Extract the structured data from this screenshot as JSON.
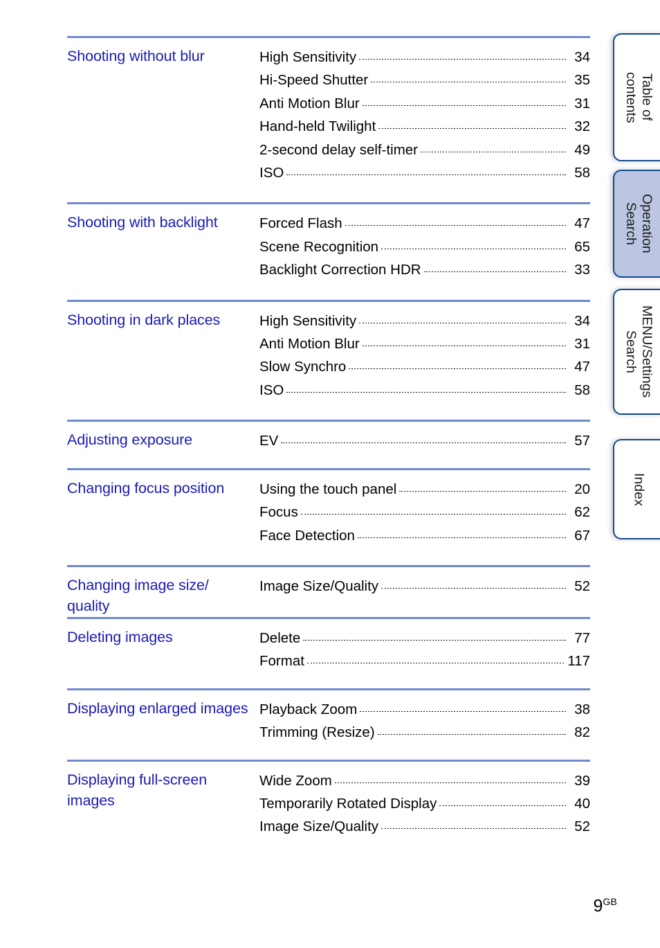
{
  "document": {
    "page_number": "9",
    "page_suffix": "GB"
  },
  "side_tabs": [
    {
      "label": "Table of\ncontents",
      "active": false
    },
    {
      "label": "Operation\nSearch",
      "active": true
    },
    {
      "label": "MENU/Settings\nSearch",
      "active": false
    },
    {
      "label": "Index",
      "active": false
    }
  ],
  "toc": {
    "sections": [
      {
        "title": "Shooting without blur",
        "entries": [
          {
            "label": "High Sensitivity",
            "page": "34"
          },
          {
            "label": "Hi-Speed Shutter",
            "page": "35"
          },
          {
            "label": "Anti Motion Blur",
            "page": "31"
          },
          {
            "label": "Hand-held Twilight",
            "page": "32"
          },
          {
            "label": "2-second delay self-timer",
            "page": "49"
          },
          {
            "label": "ISO",
            "page": "58"
          }
        ]
      },
      {
        "title": "Shooting with backlight",
        "entries": [
          {
            "label": "Forced Flash",
            "page": "47"
          },
          {
            "label": "Scene Recognition",
            "page": "65"
          },
          {
            "label": "Backlight Correction HDR",
            "page": "33"
          }
        ]
      },
      {
        "title": "Shooting in dark places",
        "entries": [
          {
            "label": "High Sensitivity",
            "page": "34"
          },
          {
            "label": "Anti Motion Blur",
            "page": "31"
          },
          {
            "label": "Slow Synchro",
            "page": "47"
          },
          {
            "label": "ISO",
            "page": "58"
          }
        ]
      },
      {
        "title": "Adjusting exposure",
        "entries": [
          {
            "label": "EV",
            "page": "57"
          }
        ]
      },
      {
        "title": "Changing focus position",
        "entries": [
          {
            "label": "Using the touch panel",
            "page": "20"
          },
          {
            "label": "Focus",
            "page": "62"
          },
          {
            "label": "Face Detection",
            "page": "67"
          }
        ]
      },
      {
        "title": "Changing image size/ quality",
        "entries": [
          {
            "label": "Image Size/Quality",
            "page": "52"
          }
        ]
      },
      {
        "title": "Deleting images",
        "entries": [
          {
            "label": "Delete",
            "page": "77"
          },
          {
            "label": "Format",
            "page": "117"
          }
        ]
      },
      {
        "title": "Displaying enlarged images",
        "entries": [
          {
            "label": "Playback Zoom",
            "page": "38"
          },
          {
            "label": "Trimming (Resize)",
            "page": "82"
          }
        ]
      },
      {
        "title": "Displaying full-screen images",
        "entries": [
          {
            "label": "Wide Zoom",
            "page": "39"
          },
          {
            "label": "Temporarily Rotated Display",
            "page": "40"
          },
          {
            "label": "Image Size/Quality",
            "page": "52"
          }
        ]
      }
    ]
  },
  "colors": {
    "heading": "#1a1ab4",
    "divider": "#7088cc",
    "tab_border": "#14478c",
    "tab_active_fill": "#bcc6e2"
  }
}
